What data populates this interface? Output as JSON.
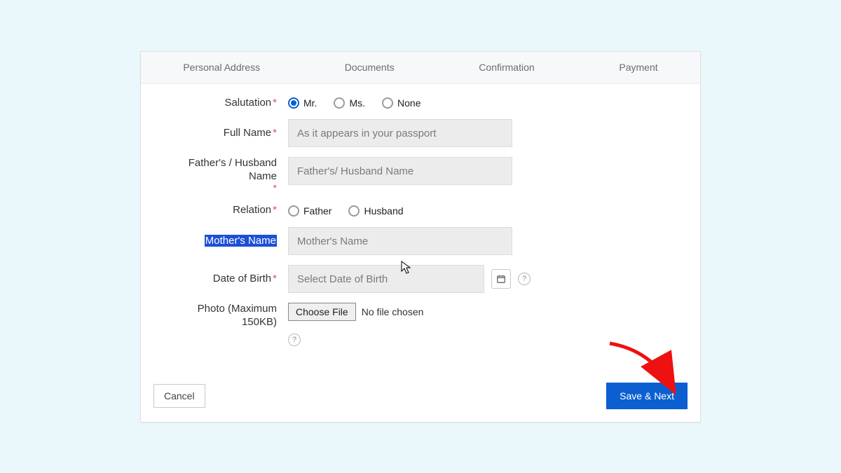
{
  "steps": {
    "personal": "Personal Address",
    "documents": "Documents",
    "confirmation": "Confirmation",
    "payment": "Payment"
  },
  "labels": {
    "salutation": "Salutation",
    "full_name": "Full Name",
    "father_husband": "Father's / Husband Name",
    "relation": "Relation",
    "mother_name": "Mother's Name",
    "dob": "Date of Birth",
    "photo": "Photo (Maximum 150KB)"
  },
  "salutation_options": {
    "mr": "Mr.",
    "ms": "Ms.",
    "none": "None"
  },
  "relation_options": {
    "father": "Father",
    "husband": "Husband"
  },
  "placeholders": {
    "full_name": "As it appears in your passport",
    "father_husband": "Father's/ Husband Name",
    "mother_name": "Mother's Name",
    "dob": "Select Date of Birth"
  },
  "file": {
    "choose": "Choose File",
    "none": "No file chosen"
  },
  "buttons": {
    "cancel": "Cancel",
    "save_next": "Save & Next"
  }
}
